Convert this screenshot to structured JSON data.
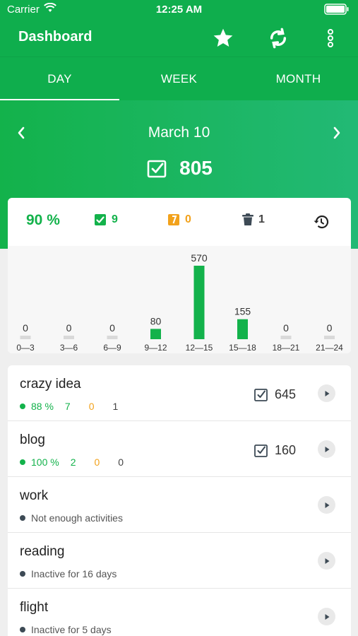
{
  "status_bar": {
    "carrier": "Carrier",
    "time": "12:25 AM"
  },
  "header": {
    "title": "Dashboard",
    "icons": [
      "star-icon",
      "sync-icon",
      "more-vertical-icon"
    ]
  },
  "tabs": [
    {
      "label": "DAY",
      "active": true
    },
    {
      "label": "WEEK",
      "active": false
    },
    {
      "label": "MONTH",
      "active": false
    }
  ],
  "day": {
    "date": "March 10",
    "total": "805"
  },
  "stats": {
    "percent": "90 %",
    "done": "9",
    "late": "0",
    "deleted": "1"
  },
  "colors": {
    "brand": "#0fae4d",
    "accent_green": "#13b24b",
    "late_orange": "#f2a21c",
    "bar_gray": "#d9d9d9"
  },
  "chart_data": {
    "type": "bar",
    "categories": [
      "0—3",
      "3—6",
      "6—9",
      "9—12",
      "12—15",
      "15—18",
      "18—21",
      "21—24"
    ],
    "values": [
      0,
      0,
      0,
      80,
      570,
      155,
      0,
      0
    ],
    "labels": [
      "0",
      "0",
      "0",
      "80",
      "570",
      "155",
      "0",
      "0"
    ],
    "ylim": [
      0,
      570
    ]
  },
  "projects": [
    {
      "name": "crazy idea",
      "percent": "88 %",
      "done": "7",
      "late": "0",
      "deleted": "1",
      "count": "645",
      "note": null
    },
    {
      "name": "blog",
      "percent": "100 %",
      "done": "2",
      "late": "0",
      "deleted": "0",
      "count": "160",
      "note": null
    },
    {
      "name": "work",
      "note": "Not enough activities"
    },
    {
      "name": "reading",
      "note": "Inactive for 16 days"
    },
    {
      "name": "flight",
      "note": "Inactive for 5 days"
    }
  ]
}
